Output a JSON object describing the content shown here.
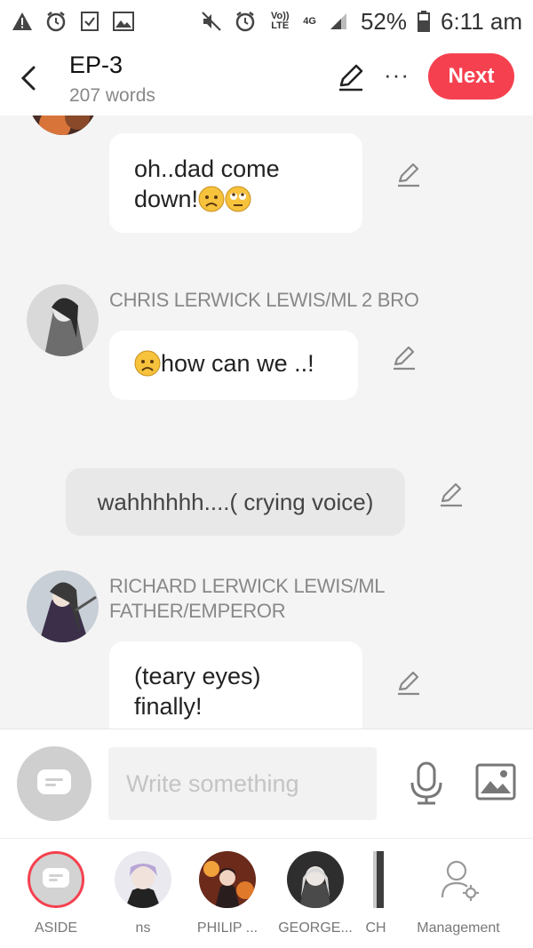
{
  "status_bar": {
    "volte": "Vo)) LTE",
    "network": "4G",
    "battery": "52%",
    "time": "6:11 am"
  },
  "header": {
    "title": "EP-3",
    "word_count": "207 words",
    "more_label": "···",
    "next_label": "Next"
  },
  "messages": [
    {
      "text_line1": "oh..dad come",
      "text_line2": "down!"
    },
    {
      "speaker": "CHRIS LERWICK LEWIS/ML 2 BRO",
      "text": "how can we ..!"
    },
    {
      "aside": "wahhhhhh....( crying voice)"
    },
    {
      "speaker_line1": "RICHARD LERWICK LEWIS/ML",
      "speaker_line2": "FATHER/EMPEROR",
      "text_line1": "(teary eyes)",
      "text_line2": "finally!"
    }
  ],
  "input": {
    "placeholder": "Write something"
  },
  "cast": [
    {
      "label": "ASIDE"
    },
    {
      "label": "ns"
    },
    {
      "label": "PHILIP ..."
    },
    {
      "label": "GEORGE..."
    },
    {
      "label": "CH"
    },
    {
      "label": "Management"
    }
  ],
  "colors": {
    "accent": "#f5414f",
    "background": "#f4f4f4",
    "bubble": "#ffffff",
    "aside_bubble": "#e8e8e8",
    "name_text": "#888888"
  }
}
